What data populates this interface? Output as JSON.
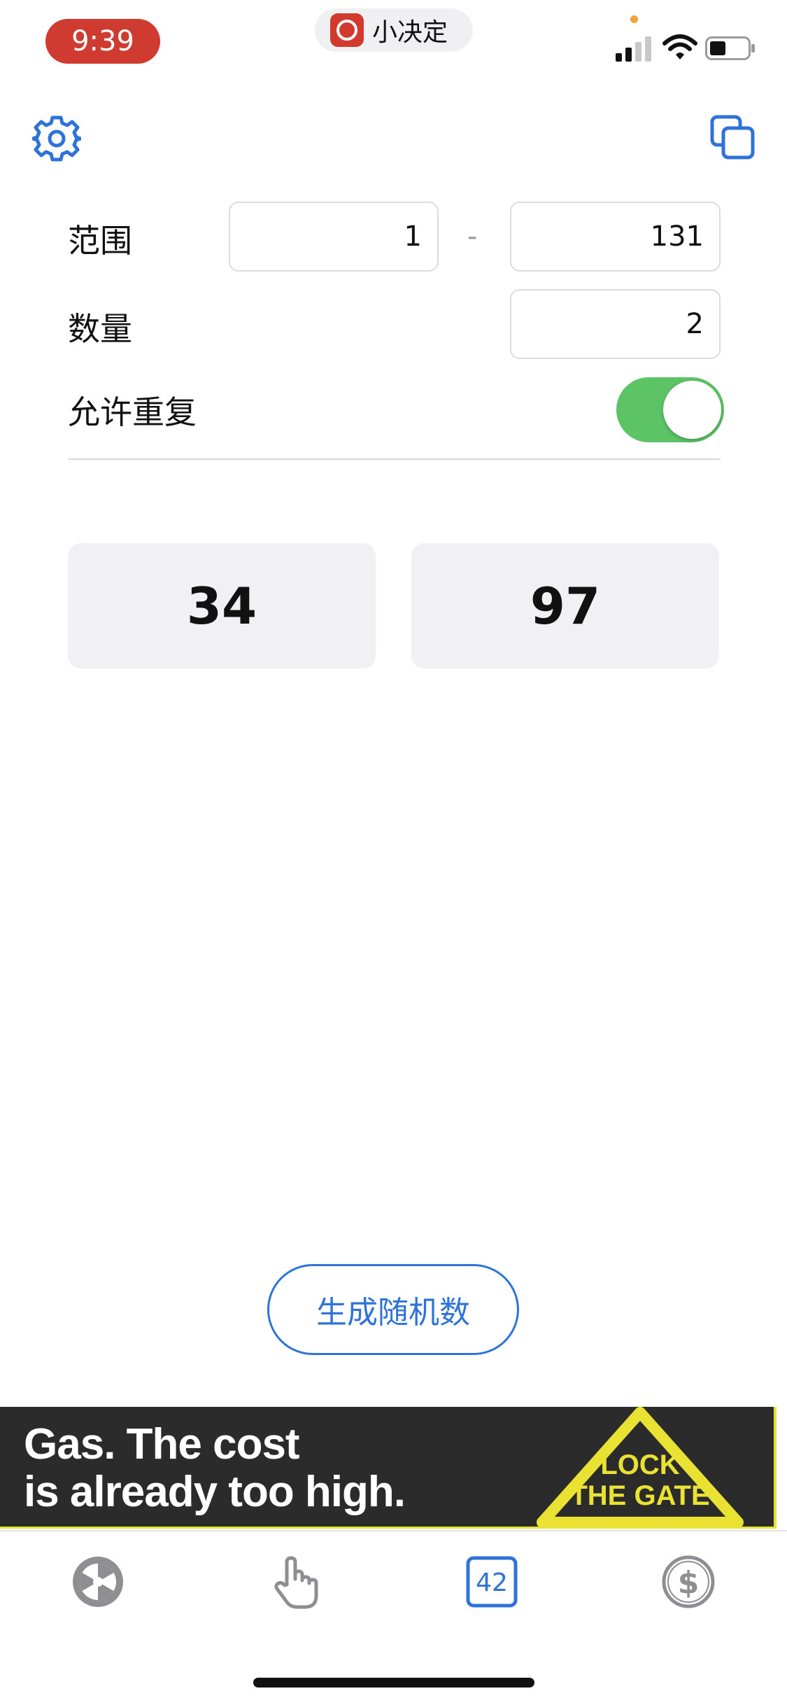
{
  "status_bar": {
    "time": "9:39",
    "app_name": "小决定"
  },
  "form": {
    "range_label": "范围",
    "range_min": "1",
    "range_separator": "-",
    "range_max": "131",
    "count_label": "数量",
    "count_value": "2",
    "allow_repeat_label": "允许重复",
    "allow_repeat_on": true
  },
  "results": [
    "34",
    "97"
  ],
  "generate_button_label": "生成随机数",
  "ad": {
    "line1": "Gas. The cost",
    "line2": "is already too high.",
    "logo_line1": "LOCK",
    "logo_line2": "THE GATE"
  },
  "tabs": [
    {
      "icon": "wheel-icon",
      "selected": false
    },
    {
      "icon": "tap-hand-icon",
      "selected": false
    },
    {
      "icon": "number-icon",
      "label": "42",
      "selected": true
    },
    {
      "icon": "dollar-coin-icon",
      "selected": false
    }
  ],
  "colors": {
    "accent": "#2f73d9",
    "toggle_on": "#5dc466",
    "time_pill": "#cf3b30",
    "result_bg": "#f1f1f5",
    "ad_yellow": "#e9e232"
  }
}
